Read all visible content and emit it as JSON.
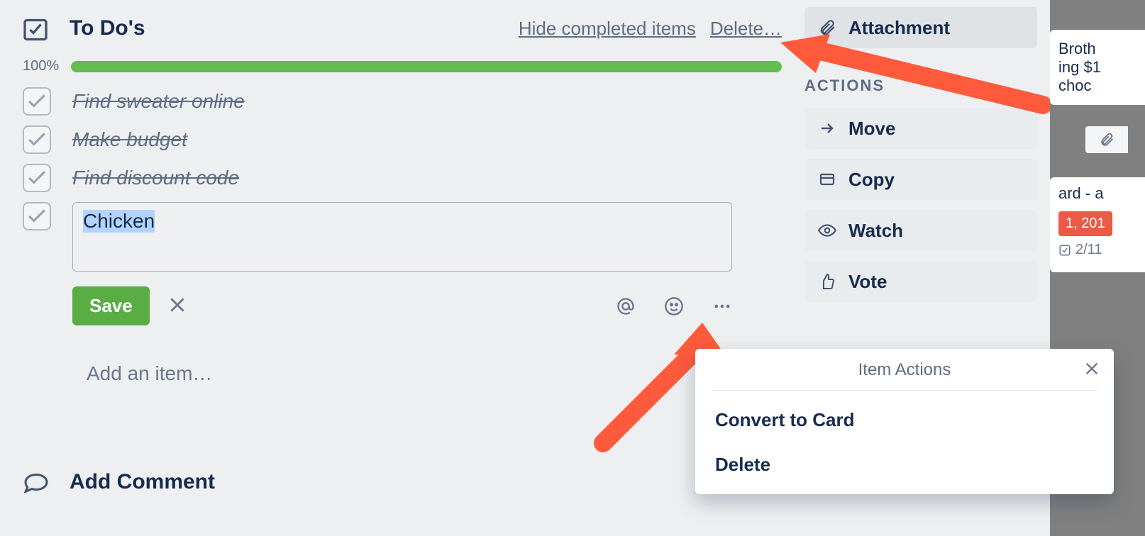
{
  "checklist": {
    "title": "To Do's",
    "hide_link": "Hide completed items",
    "delete_link": "Delete…",
    "progress": {
      "percent_label": "100%",
      "percent": 100
    },
    "items": [
      {
        "text": "Find sweater online",
        "checked": true
      },
      {
        "text": "Make budget",
        "checked": true
      },
      {
        "text": "Find discount code",
        "checked": true
      }
    ],
    "editing_item": {
      "value": "Chicken",
      "save_label": "Save"
    },
    "add_item_placeholder": "Add an item…"
  },
  "comment": {
    "title": "Add Comment"
  },
  "sidebar": {
    "attachment": "Attachment",
    "actions_heading": "ACTIONS",
    "actions": [
      {
        "key": "move",
        "label": "Move",
        "icon": "arrow-right-icon"
      },
      {
        "key": "copy",
        "label": "Copy",
        "icon": "card-icon"
      },
      {
        "key": "watch",
        "label": "Watch",
        "icon": "eye-icon"
      },
      {
        "key": "vote",
        "label": "Vote",
        "icon": "thumbs-up-icon"
      }
    ]
  },
  "popover": {
    "title": "Item Actions",
    "items": [
      {
        "label": "Convert to Card"
      },
      {
        "label": "Delete"
      }
    ]
  },
  "background_cards": {
    "card1": {
      "line1": "Broth",
      "line2": "ing $1",
      "line3": "choc"
    },
    "card2": {
      "title": "ard - a",
      "badge": "1, 201",
      "sub": "2/11"
    }
  }
}
